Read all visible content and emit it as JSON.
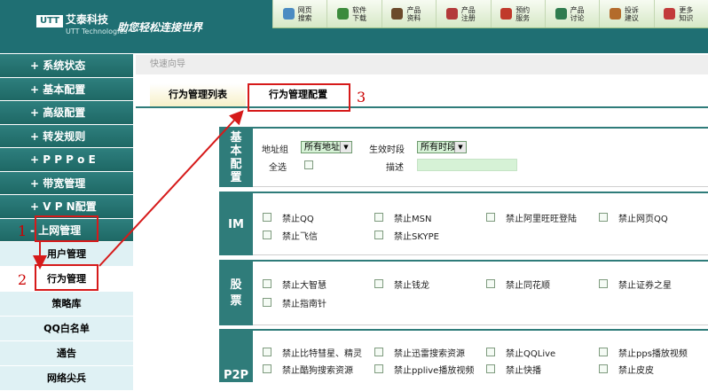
{
  "header": {
    "logo_badge": "UTT",
    "logo_cn": "艾泰科技",
    "logo_en": "UTT Technologies",
    "slogan": "助您轻松连接世界",
    "nav": [
      {
        "label": "网页搜索",
        "icon": "search-icon",
        "color": "#4a8bc2"
      },
      {
        "label": "软件下载",
        "icon": "download-icon",
        "color": "#3c8b3c"
      },
      {
        "label": "产品资料",
        "icon": "book-icon",
        "color": "#6b4a2b"
      },
      {
        "label": "产品注册",
        "icon": "register-icon",
        "color": "#b33a3a"
      },
      {
        "label": "预约服务",
        "icon": "phone-icon",
        "color": "#c0392b"
      },
      {
        "label": "产品讨论",
        "icon": "users-icon",
        "color": "#2f7c4f"
      },
      {
        "label": "投诉建议",
        "icon": "user-icon",
        "color": "#b36b2b"
      },
      {
        "label": "更多知识",
        "icon": "info-icon",
        "color": "#c23b3b"
      }
    ]
  },
  "sidebar": {
    "menu": [
      {
        "label": "+ 系统状态"
      },
      {
        "label": "+ 基本配置"
      },
      {
        "label": "+ 高级配置"
      },
      {
        "label": "+ 转发规则"
      },
      {
        "label": "+ P P P o E"
      },
      {
        "label": "+ 带宽管理"
      },
      {
        "label": "+ V P N配置"
      },
      {
        "label": "- 上网管理"
      }
    ],
    "sub": [
      {
        "label": "用户管理"
      },
      {
        "label": "行为管理"
      },
      {
        "label": "策略库"
      },
      {
        "label": "QQ白名单"
      },
      {
        "label": "通告"
      },
      {
        "label": "网络尖兵"
      }
    ]
  },
  "breadcrumb": "快速向导",
  "tabs": [
    {
      "label": "行为管理列表"
    },
    {
      "label": "行为管理配置"
    }
  ],
  "annotations": [
    "1",
    "2",
    "3"
  ],
  "basic": {
    "label": "基本配置",
    "address_group_label": "地址组",
    "address_group_value": "所有地址",
    "time_label": "生效时段",
    "time_value": "所有时段",
    "select_all_label": "全选",
    "description_label": "描述"
  },
  "im": {
    "label": "IM",
    "items": [
      "禁止QQ",
      "禁止MSN",
      "禁止阿里旺旺登陆",
      "禁止网页QQ",
      "禁止飞信",
      "禁止SKYPE"
    ]
  },
  "stock": {
    "label": "股票",
    "items": [
      "禁止大智慧",
      "禁止钱龙",
      "禁止同花顺",
      "禁止证券之星",
      "禁止指南针"
    ]
  },
  "p2p": {
    "label": "P2P",
    "items": [
      "禁止比特彗星、精灵",
      "禁止迅雷搜索资源",
      "禁止QQLive",
      "禁止pps播放视频",
      "禁止酷狗搜索资源",
      "禁止pplive播放视频",
      "禁止快播",
      "禁止皮皮"
    ]
  },
  "colors": {
    "header": "#1f6f73",
    "sidebar": "#2e7f7e",
    "annotation": "#d61a1a"
  }
}
